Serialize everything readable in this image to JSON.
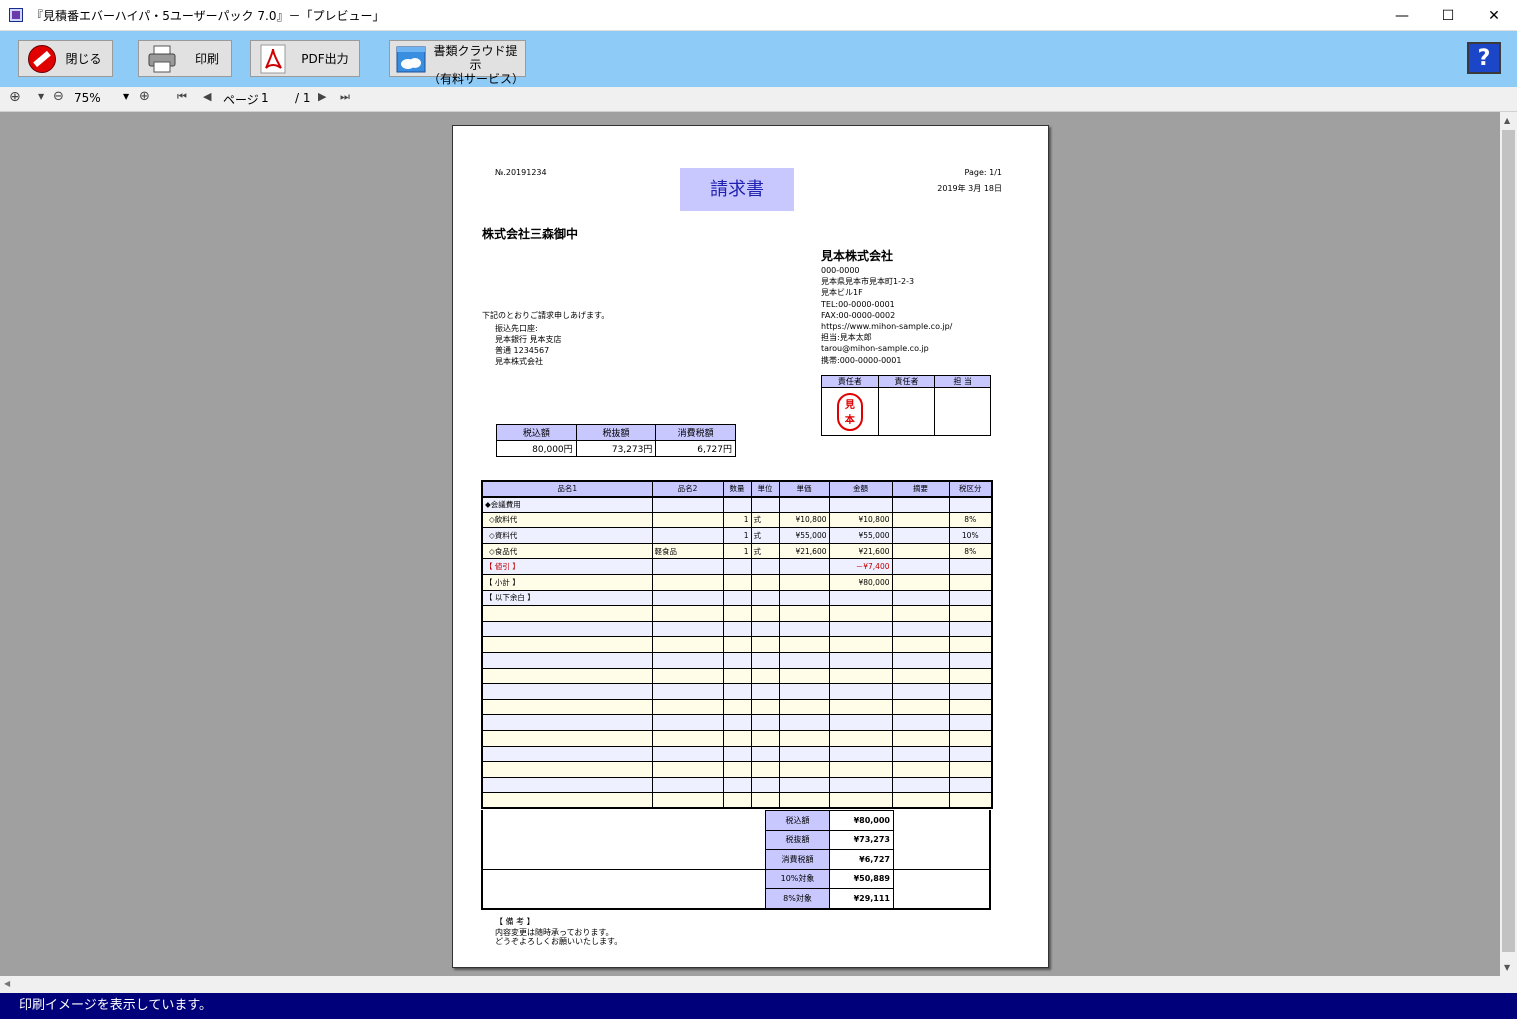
{
  "window": {
    "title": "『見積番エバーハイパ・5ユーザーパック 7.0』－「プレビュー」",
    "minimize": "—",
    "maximize": "☐",
    "close": "✕"
  },
  "toolbar": {
    "close_label": "閉じる",
    "print_label": "印刷",
    "pdf_label": "PDF出力",
    "cloud_label_line1": "書類クラウド提示",
    "cloud_label_line2": "（有料サービス）",
    "pdf_icon_text": "PDF",
    "help_label": "?"
  },
  "nav": {
    "zoom_value": "75%",
    "page_label": "ページ",
    "page_current": "1",
    "page_total": "/ 1"
  },
  "status": {
    "text": "印刷イメージを表示しています。"
  },
  "invoice": {
    "number": "№.20191234",
    "title": "請求書",
    "page_info": "Page: 1/1",
    "date": "2019年 3月 18日",
    "recipient": "株式会社三森御中",
    "company": {
      "name": "見本株式会社",
      "lines": [
        "000-0000",
        "見本県見本市見本町1-2-3",
        "見本ビル1F",
        "TEL:00-0000-0001",
        "FAX:00-0000-0002",
        "https://www.mihon-sample.co.jp/",
        "担当:見本太郎",
        "tarou@mihon-sample.co.jp",
        "携帯:000-0000-0001"
      ]
    },
    "message": "下記のとおりご請求申しあげます。",
    "bank": {
      "label": "振込先口座:",
      "lines": [
        "見本銀行 見本支店",
        "普通 1234567",
        "見本株式会社"
      ]
    },
    "responsible": {
      "headers": [
        "責任者",
        "責任者",
        "担 当"
      ],
      "stamp_line1": "見",
      "stamp_line2": "本"
    },
    "summary": {
      "headers": [
        "税込額",
        "税抜額",
        "消費税額"
      ],
      "values": [
        "80,000円",
        "73,273円",
        "6,727円"
      ]
    },
    "items": {
      "headers": [
        "品名1",
        "品名2",
        "数量",
        "単位",
        "単価",
        "金額",
        "摘要",
        "税区分"
      ],
      "rows": [
        [
          "◆会議費用",
          "",
          "",
          "",
          "",
          "",
          "",
          ""
        ],
        [
          "◇飲料代",
          "",
          "1",
          "式",
          "¥10,800",
          "¥10,800",
          "",
          "8%"
        ],
        [
          "◇資料代",
          "",
          "1",
          "式",
          "¥55,000",
          "¥55,000",
          "",
          "10%"
        ],
        [
          "◇食品代",
          "軽食品",
          "1",
          "式",
          "¥21,600",
          "¥21,600",
          "",
          "8%"
        ],
        [
          "【 値引 】",
          "",
          "",
          "",
          "",
          "－¥7,400",
          "",
          ""
        ],
        [
          "【 小計 】",
          "",
          "",
          "",
          "",
          "¥80,000",
          "",
          ""
        ],
        [
          "【 以下余白 】",
          "",
          "",
          "",
          "",
          "",
          "",
          ""
        ],
        [
          "",
          "",
          "",
          "",
          "",
          "",
          "",
          ""
        ],
        [
          "",
          "",
          "",
          "",
          "",
          "",
          "",
          ""
        ],
        [
          "",
          "",
          "",
          "",
          "",
          "",
          "",
          ""
        ],
        [
          "",
          "",
          "",
          "",
          "",
          "",
          "",
          ""
        ],
        [
          "",
          "",
          "",
          "",
          "",
          "",
          "",
          ""
        ],
        [
          "",
          "",
          "",
          "",
          "",
          "",
          "",
          ""
        ],
        [
          "",
          "",
          "",
          "",
          "",
          "",
          "",
          ""
        ],
        [
          "",
          "",
          "",
          "",
          "",
          "",
          "",
          ""
        ],
        [
          "",
          "",
          "",
          "",
          "",
          "",
          "",
          ""
        ],
        [
          "",
          "",
          "",
          "",
          "",
          "",
          "",
          ""
        ],
        [
          "",
          "",
          "",
          "",
          "",
          "",
          "",
          ""
        ],
        [
          "",
          "",
          "",
          "",
          "",
          "",
          "",
          ""
        ],
        [
          "",
          "",
          "",
          "",
          "",
          "",
          "",
          ""
        ]
      ]
    },
    "totals": [
      {
        "label": "税込額",
        "value": "¥80,000"
      },
      {
        "label": "税抜額",
        "value": "¥73,273"
      },
      {
        "label": "消費税額",
        "value": "¥6,727"
      },
      {
        "label": "10%対象",
        "value": "¥50,889"
      },
      {
        "label": "8%対象",
        "value": "¥29,111"
      }
    ],
    "remarks": {
      "label": "【 備 考 】",
      "line1": "内容変更は随時承っております。",
      "line2": "どうぞよろしくお願いいたします。"
    }
  }
}
